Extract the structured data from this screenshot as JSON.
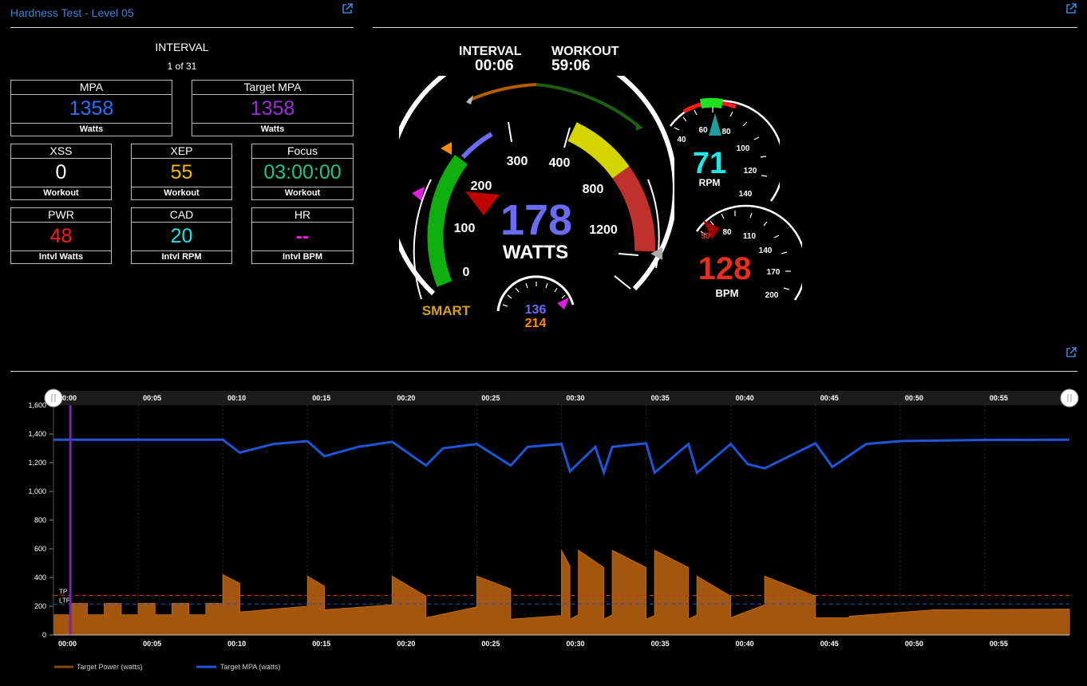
{
  "panel": {
    "title": "Hardness Test - Level 05"
  },
  "interval_header": {
    "label": "INTERVAL",
    "value": "1 of 31"
  },
  "tiles": {
    "mpa": {
      "label": "MPA",
      "value": "1358",
      "unit": "Watts",
      "color": "#2f6ff7"
    },
    "target_mpa": {
      "label": "Target MPA",
      "value": "1358",
      "unit": "Watts",
      "color": "#9b2fd6"
    },
    "xss": {
      "label": "XSS",
      "value": "0",
      "unit": "Workout",
      "color": "#ffffff"
    },
    "xep": {
      "label": "XEP",
      "value": "55",
      "unit": "Workout",
      "color": "#f5b800"
    },
    "focus": {
      "label": "Focus",
      "value": "03:00:00",
      "unit": "Workout",
      "color": "#26c281"
    },
    "pwr": {
      "label": "PWR",
      "value": "48",
      "unit": "Intvl Watts",
      "color": "#ff1a1a"
    },
    "cad": {
      "label": "CAD",
      "value": "20",
      "unit": "Intvl RPM",
      "color": "#22e5e5"
    },
    "hr": {
      "label": "HR",
      "value": "--",
      "unit": "Intvl BPM",
      "color": "#e01ee0"
    }
  },
  "timers": {
    "interval_label": "INTERVAL",
    "interval_value": "00:06",
    "workout_label": "WORKOUT",
    "workout_value": "59:06"
  },
  "power_gauge": {
    "value": "178",
    "unit": "WATTS",
    "mode": "SMART",
    "ticks": [
      "0",
      "100",
      "200",
      "300",
      "400",
      "800",
      "1200"
    ],
    "small_top": "136",
    "small_bottom": "214",
    "colors": {
      "value": "#6b6bf5",
      "green": "#0fae0f",
      "yellow": "#d4d400",
      "red": "#c0302c",
      "mode": "#d4a017"
    }
  },
  "rpm_gauge": {
    "value": "71",
    "unit": "RPM",
    "ticks": [
      "40",
      "60",
      "80",
      "100",
      "120",
      "140"
    ],
    "color": "#22e5e5"
  },
  "bpm_gauge": {
    "value": "128",
    "unit": "BPM",
    "ticks": [
      "50",
      "80",
      "110",
      "140",
      "170",
      "200"
    ],
    "color": "#e52e1e"
  },
  "chart_data": {
    "type": "area",
    "x_ticks": [
      "00:00",
      "00:05",
      "00:10",
      "00:15",
      "00:20",
      "00:25",
      "00:30",
      "00:35",
      "00:40",
      "00:45",
      "00:50",
      "00:55"
    ],
    "y_ticks": [
      "0",
      "200",
      "400",
      "600",
      "800",
      "1,000",
      "1,200",
      "1,400",
      "1,600"
    ],
    "ylim": [
      0,
      1600
    ],
    "xlim": [
      0,
      60
    ],
    "reference_lines": [
      {
        "label": "TP",
        "value": 275
      },
      {
        "label": "LTP",
        "value": 215
      }
    ],
    "cursor_x": 1,
    "series": [
      {
        "name": "Target Power (watts)",
        "color": "#8b4a0e",
        "x": [
          0,
          1,
          1,
          2,
          2,
          3,
          3,
          4,
          4,
          5,
          5,
          6,
          6,
          7,
          7,
          8,
          8,
          9,
          9,
          10,
          10,
          11,
          11,
          15,
          15,
          16,
          16,
          20,
          20,
          22,
          22,
          25,
          25,
          27,
          27,
          30,
          30,
          30.5,
          30.5,
          31,
          31,
          32.5,
          32.5,
          33,
          33,
          35,
          35,
          35.5,
          35.5,
          37.5,
          37.5,
          38,
          38,
          40,
          40,
          42,
          42,
          45,
          45,
          47,
          47,
          52,
          60
        ],
        "values": [
          140,
          140,
          220,
          220,
          140,
          140,
          220,
          220,
          140,
          140,
          220,
          220,
          140,
          140,
          220,
          220,
          140,
          140,
          220,
          220,
          420,
          360,
          160,
          200,
          410,
          340,
          175,
          210,
          410,
          270,
          120,
          195,
          410,
          320,
          110,
          135,
          590,
          480,
          110,
          140,
          590,
          470,
          110,
          140,
          590,
          470,
          110,
          135,
          590,
          470,
          110,
          140,
          410,
          270,
          120,
          210,
          410,
          270,
          120,
          120,
          130,
          175,
          180
        ]
      },
      {
        "name": "Target MPA (watts)",
        "color": "#1f55d6",
        "x": [
          0,
          10,
          11,
          13,
          15,
          16,
          18,
          20,
          22,
          23,
          25,
          27,
          28,
          30,
          30.5,
          32,
          32.5,
          33,
          35,
          35.5,
          37.5,
          38,
          40,
          41,
          42,
          45,
          46,
          48,
          50,
          55,
          60
        ],
        "values": [
          1360,
          1360,
          1270,
          1330,
          1350,
          1245,
          1310,
          1345,
          1180,
          1300,
          1330,
          1180,
          1310,
          1330,
          1140,
          1310,
          1130,
          1310,
          1335,
          1130,
          1330,
          1130,
          1330,
          1190,
          1160,
          1335,
          1170,
          1330,
          1350,
          1358,
          1360
        ]
      }
    ]
  }
}
